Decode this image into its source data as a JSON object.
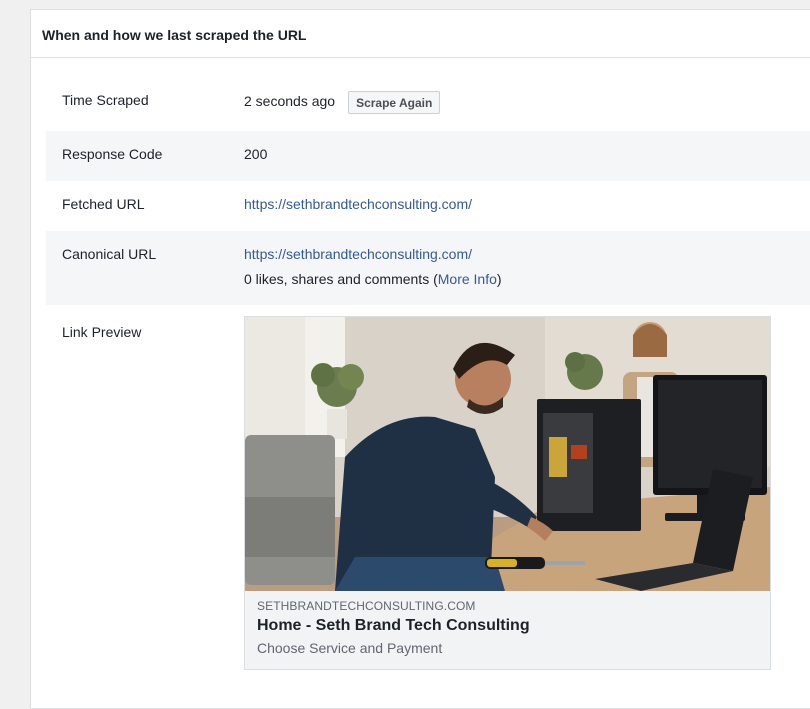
{
  "panel": {
    "title": "When and how we last scraped the URL"
  },
  "rows": {
    "time_scraped": {
      "label": "Time Scraped",
      "value": "2 seconds ago",
      "button": "Scrape Again"
    },
    "response_code": {
      "label": "Response Code",
      "value": "200"
    },
    "fetched_url": {
      "label": "Fetched URL",
      "value": "https://sethbrandtechconsulting.com/"
    },
    "canonical_url": {
      "label": "Canonical URL",
      "value": "https://sethbrandtechconsulting.com/",
      "engagement_prefix": "0 likes, shares and comments (",
      "more_info": "More Info",
      "engagement_suffix": ")"
    },
    "link_preview": {
      "label": "Link Preview",
      "domain": "SETHBRANDTECHCONSULTING.COM",
      "title": "Home - Seth Brand Tech Consulting",
      "description": "Choose Service and Payment"
    }
  },
  "colors": {
    "link": "#365899",
    "alt_row": "#f5f6f7",
    "border": "#dddfe2"
  }
}
